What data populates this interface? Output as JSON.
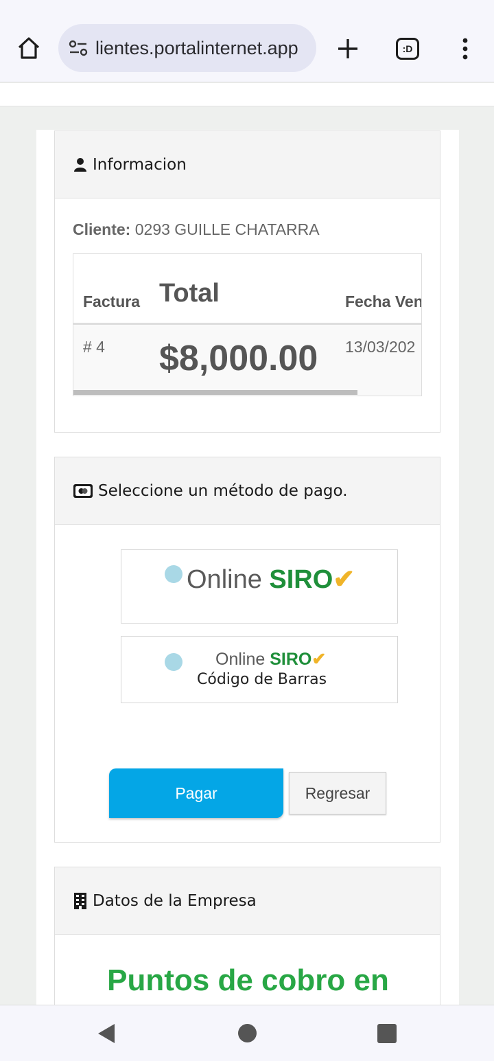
{
  "browser": {
    "url": "lientes.portalinternet.app",
    "tabs_label": ":D",
    "icons": [
      "home-icon",
      "site-settings-icon",
      "plus-icon",
      "tabs-icon",
      "menu-dots-icon"
    ]
  },
  "info_panel": {
    "title": "Informacion",
    "icon": "user-icon",
    "cliente_label": "Cliente:",
    "cliente_value": "0293 GUILLE CHATARRA",
    "table": {
      "headers": [
        "Factura",
        "Total",
        "Fecha Ven"
      ],
      "row": {
        "factura": "# 4",
        "total": "$8,000.00",
        "fecha": "13/03/202"
      }
    }
  },
  "payment_panel": {
    "title": "Seleccione un método de pago.",
    "icon": "credit-card-icon",
    "options": [
      {
        "online": "Online",
        "brand": "SIRO",
        "check": "✔"
      },
      {
        "online": "Online",
        "brand": "SIRO",
        "check": "✔",
        "subtitle": "Código de Barras"
      }
    ],
    "pagar_label": "Pagar",
    "regresar_label": "Regresar"
  },
  "empresa_panel": {
    "title": "Datos de la Empresa",
    "icon": "building-icon",
    "heading": "Puntos de cobro en"
  },
  "colors": {
    "accent_blue": "#04a6e6",
    "siro_green": "#1f8f3a",
    "siro_yellow": "#f0b429",
    "heading_green": "#28a745"
  },
  "system_nav": [
    "back-icon",
    "home-circle-icon",
    "recents-icon"
  ]
}
